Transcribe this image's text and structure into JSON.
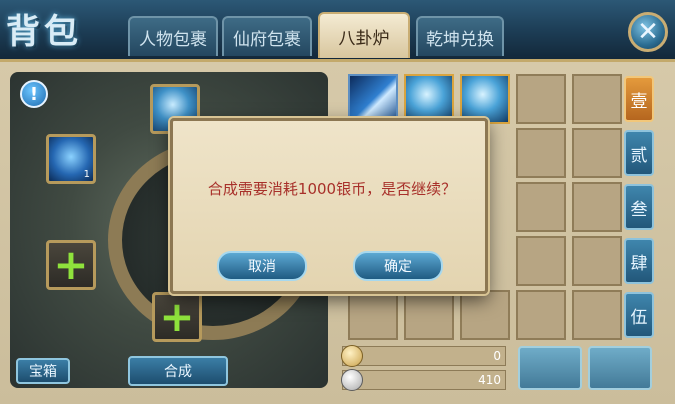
{
  "header": {
    "title": "背包",
    "tabs": [
      {
        "label": "人物包裹",
        "active": false
      },
      {
        "label": "仙府包裹",
        "active": false
      },
      {
        "label": "八卦炉",
        "active": true
      },
      {
        "label": "乾坤兑换",
        "active": false
      }
    ],
    "close_icon": "close-icon"
  },
  "left": {
    "info_icon": "info-icon",
    "material_count": "1",
    "chest_button": "宝箱",
    "combine_button": "合成"
  },
  "side_tabs": [
    "壹",
    "贰",
    "叁",
    "肆",
    "伍"
  ],
  "currency": {
    "gold": "0",
    "silver": "410"
  },
  "dialog": {
    "message": "合成需要消耗1000银币，是否继续？",
    "cancel": "取消",
    "confirm": "确定"
  },
  "colors": {
    "accent": "#c9ad73",
    "dialog_text": "#a8302a",
    "active_side_tab": "#e49a3c"
  }
}
